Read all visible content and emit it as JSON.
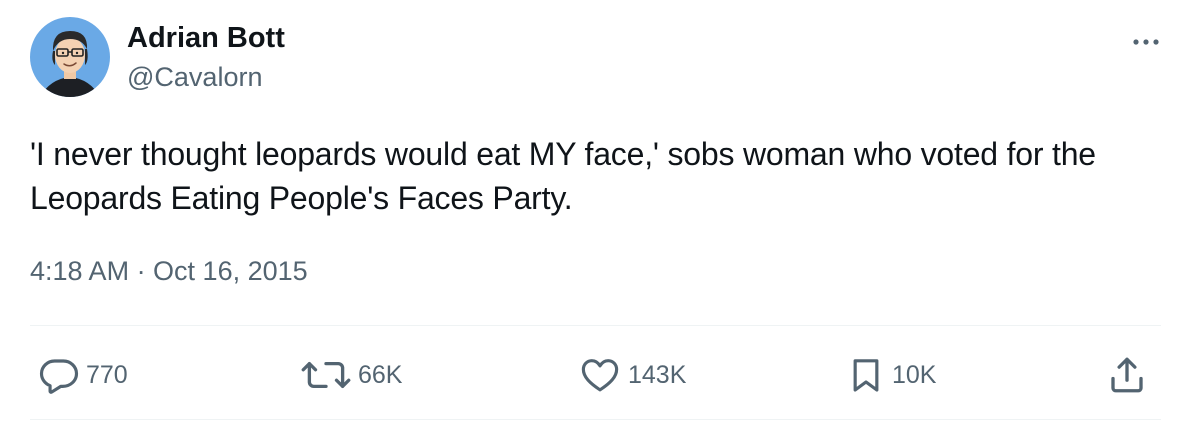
{
  "author": {
    "name": "Adrian Bott",
    "handle": "@Cavalorn",
    "avatar_icon": "cartoon-avatar-icon"
  },
  "tweet": {
    "text": "'I never thought leopards would eat MY face,' sobs woman who voted for the Leopards Eating People's Faces Party.",
    "timestamp": "4:18 AM · Oct 16, 2015"
  },
  "actions": {
    "replies": "770",
    "retweets": "66K",
    "likes": "143K",
    "bookmarks": "10K"
  },
  "icons": {
    "more": "more-options-icon",
    "reply": "reply-icon",
    "retweet": "retweet-icon",
    "like": "heart-icon",
    "bookmark": "bookmark-icon",
    "share": "share-icon"
  },
  "colors": {
    "text": "#0f1419",
    "secondary": "#536471",
    "avatar_bg": "#6aa9e6"
  }
}
